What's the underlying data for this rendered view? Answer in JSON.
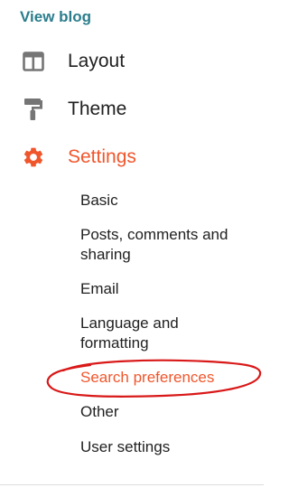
{
  "header": {
    "view_blog_label": "View blog"
  },
  "nav": {
    "items": [
      {
        "label": "Layout",
        "icon": "layout-icon"
      },
      {
        "label": "Theme",
        "icon": "paint-roller-icon"
      },
      {
        "label": "Settings",
        "icon": "gear-icon"
      }
    ],
    "active_item": "Settings"
  },
  "settings_submenu": {
    "items": [
      {
        "label": "Basic"
      },
      {
        "label_line1": "Posts, comments and",
        "label_line2": "sharing"
      },
      {
        "label": "Email"
      },
      {
        "label_line1": "Language and",
        "label_line2": "formatting"
      },
      {
        "label": "Search preferences"
      },
      {
        "label": "Other"
      },
      {
        "label": "User settings"
      }
    ],
    "active_item": "Search preferences"
  },
  "colors": {
    "accent": "#f0562c",
    "link": "#2b7d8c",
    "text": "#212121",
    "icon_gray": "#757575",
    "annotation_red": "#d91818"
  }
}
